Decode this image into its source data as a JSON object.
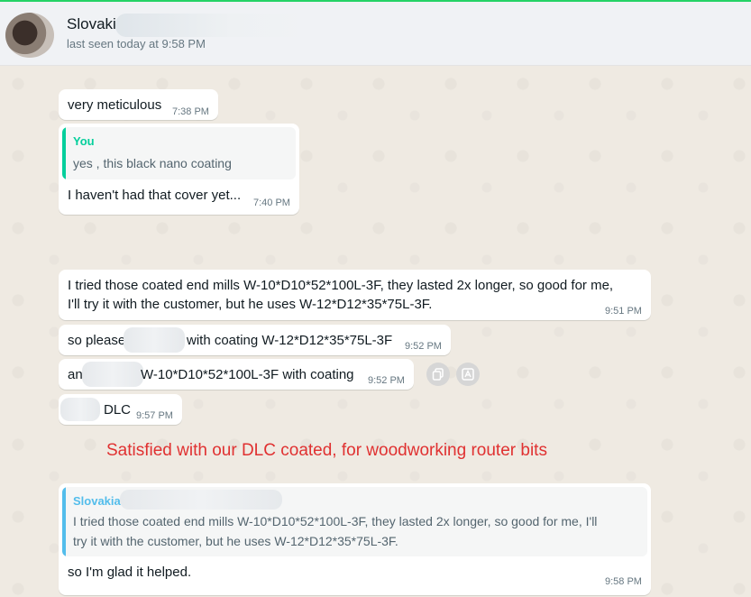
{
  "header": {
    "contact_name": "Slovaki",
    "last_seen": "last seen today at 9:58 PM"
  },
  "messages": [
    {
      "text": "very meticulous",
      "time": "7:38 PM"
    },
    {
      "quote_author": "You",
      "quote_text": "yes , this black nano coating",
      "text": "I haven't had that cover yet...",
      "time": "7:40 PM"
    },
    {
      "line1": "I tried those coated end mills W-10*D10*52*100L-3F, they lasted 2x longer, so good for me,",
      "line2": "I'll try it with the customer, but he uses W-12*D12*35*75L-3F.",
      "time": "9:51 PM"
    },
    {
      "part1": "so please",
      "part2": "with coating W-12*D12*35*75L-3F",
      "time": "9:52 PM"
    },
    {
      "part1": "an",
      "part2": "W-10*D10*52*100L-3F with coating",
      "time": "9:52 PM"
    },
    {
      "text": "DLC",
      "time": "9:57 PM"
    },
    {
      "quote_author": "Slovakia",
      "quote_line1": "I tried those coated end mills W-10*D10*52*100L-3F, they lasted 2x longer, so good for me, I'll",
      "quote_line2": "try it with the customer, but he uses W-12*D12*35*75L-3F.",
      "text": "so I'm glad it helped.",
      "time": "9:58 PM"
    }
  ],
  "annotation": "Satisfied with our DLC coated, for woodworking router bits",
  "colors": {
    "you_quote": "#06cf9c",
    "contact_quote": "#53bdeb",
    "annotation": "#e03131"
  },
  "icons": {
    "copy": "copy-icon",
    "translate": "translate-icon"
  }
}
